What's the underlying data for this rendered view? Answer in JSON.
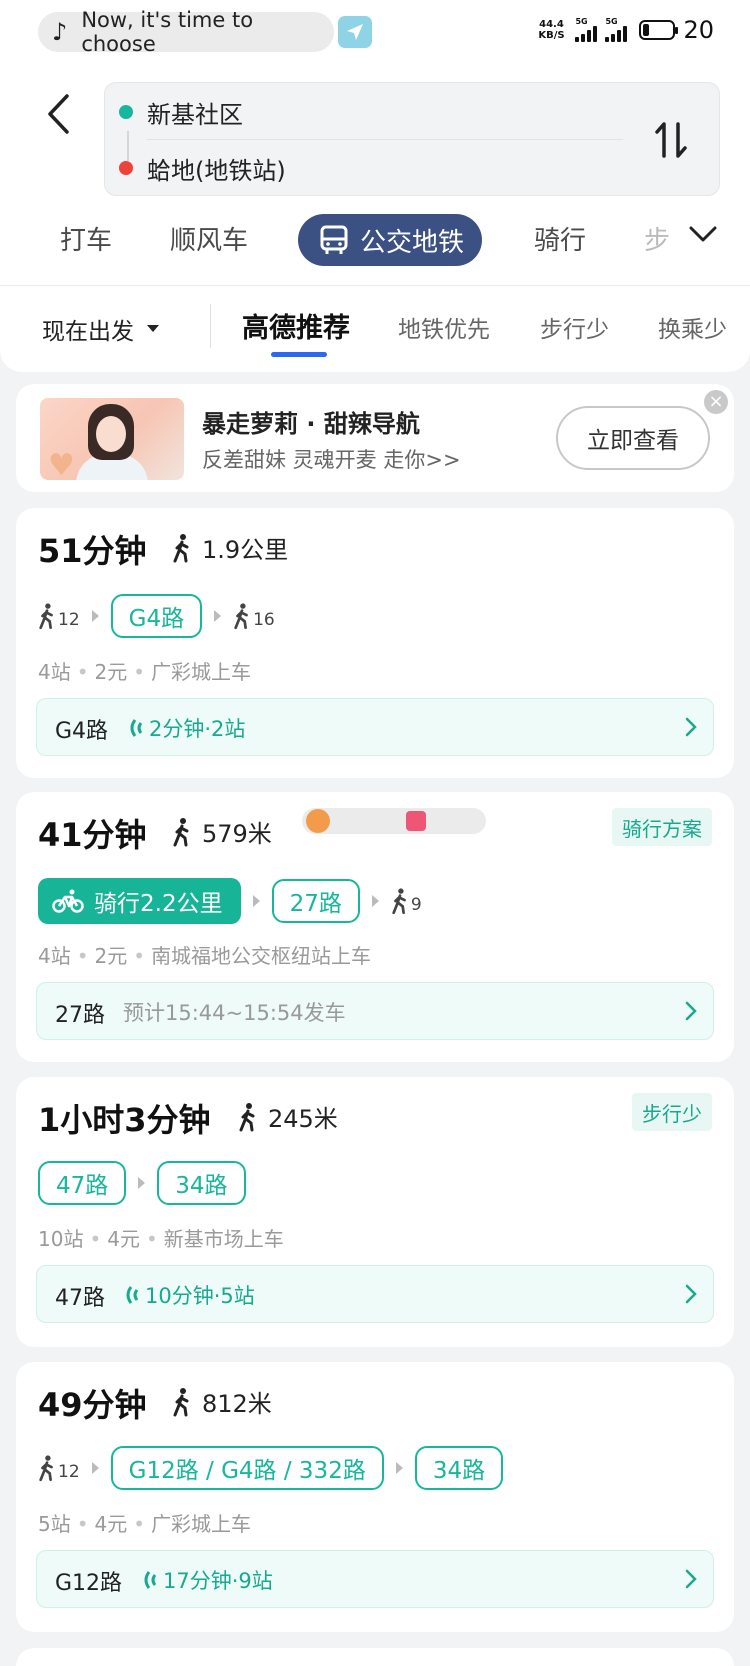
{
  "status": {
    "now_playing": "Now, it's time to choose",
    "net_speed_value": "44.4",
    "net_speed_unit": "KB/S",
    "sig1": "5G",
    "sig2": "5G",
    "battery": "20"
  },
  "route": {
    "from": "新基社区",
    "to": "蛤地(地铁站)"
  },
  "modes": [
    "打车",
    "顺风车",
    "公交地铁",
    "骑行",
    "步"
  ],
  "depart": "现在出发",
  "prefs": [
    "高德推荐",
    "地铁优先",
    "步行少",
    "换乘少"
  ],
  "ad": {
    "title": "暴走萝莉 · 甜辣导航",
    "subtitle": "反差甜妹 灵魂开麦 走你>>",
    "button": "立即查看"
  },
  "cards": [
    {
      "time": "51分钟",
      "walk": "1.9公里",
      "walk_before": "12",
      "line": "G4路",
      "walk_after": "16",
      "stops": "4站",
      "fare": "2元",
      "board": "广彩城上车",
      "rt_line": "G4路",
      "rt_info": "2分钟·2站"
    },
    {
      "time": "41分钟",
      "walk": "579米",
      "tag": "骑行方案",
      "bike": "骑行2.2公里",
      "line": "27路",
      "walk_after": "9",
      "stops": "4站",
      "fare": "2元",
      "board": "南城福地公交枢纽站上车",
      "rt_line": "27路",
      "rt_info": "预计15:44~15:54发车"
    },
    {
      "time": "1小时3分钟",
      "walk": "245米",
      "tag": "步行少",
      "line1": "47路",
      "line2": "34路",
      "stops": "10站",
      "fare": "4元",
      "board": "新基市场上车",
      "rt_line": "47路",
      "rt_info": "10分钟·5站"
    },
    {
      "time": "49分钟",
      "walk": "812米",
      "walk_before": "12",
      "line1": "G12路 / G4路 / 332路",
      "line2": "34路",
      "stops": "5站",
      "fare": "4元",
      "board": "广彩城上车",
      "rt_line": "G12路",
      "rt_info": "17分钟·9站"
    }
  ],
  "colors": {
    "accent": "#17b79b",
    "active_mode_bg": "#3b5183",
    "pref_underline": "#2d68f2",
    "start_dot": "#17b79b",
    "end_dot": "#f0413a"
  }
}
